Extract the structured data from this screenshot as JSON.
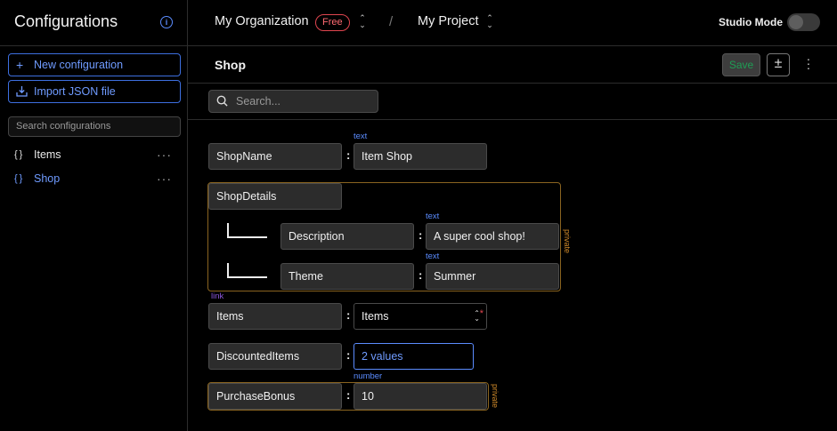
{
  "sidebar": {
    "title": "Configurations",
    "new_config_label": "New configuration",
    "import_label": "Import JSON file",
    "search_placeholder": "Search configurations",
    "items": [
      {
        "label": "Items",
        "icon": "braces-icon",
        "menu": "···"
      },
      {
        "label": "Shop",
        "icon": "braces-icon",
        "menu": "···"
      }
    ]
  },
  "topbar": {
    "organization": "My Organization",
    "plan_badge": "Free",
    "separator": "/",
    "project": "My Project",
    "studio_mode_label": "Studio Mode",
    "studio_mode_on": false
  },
  "page": {
    "title": "Shop",
    "save_label": "Save",
    "add_remove_label": "±",
    "search_placeholder": "Search..."
  },
  "fields": {
    "shop_name": {
      "key": "ShopName",
      "type": "text",
      "value": "Item Shop"
    },
    "shop_details": {
      "key": "ShopDetails",
      "private_label": "private",
      "description": {
        "key": "Description",
        "type": "text",
        "value": "A super cool shop!"
      },
      "theme": {
        "key": "Theme",
        "type": "text",
        "value": "Summer"
      }
    },
    "items": {
      "key": "Items",
      "type": "link",
      "value": "Items",
      "required_mark": "*"
    },
    "discounted_items": {
      "key": "DiscountedItems",
      "value": "2 values"
    },
    "purchase_bonus": {
      "key": "PurchaseBonus",
      "type": "number",
      "value": "10",
      "private_label": "private"
    }
  },
  "colors": {
    "accent": "#5b8cff",
    "private_border": "#8a6420",
    "badge": "#e0454f",
    "link_type": "#8a55d9"
  }
}
